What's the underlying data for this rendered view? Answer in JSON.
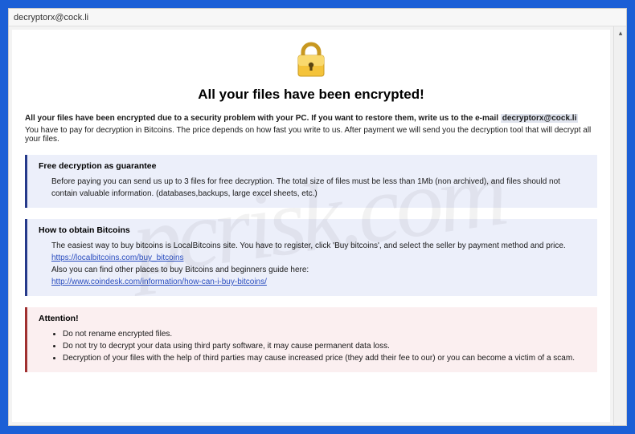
{
  "window": {
    "title": "decryptorx@cock.li"
  },
  "scrollbar": {
    "up": "▴"
  },
  "header": {
    "main_title": "All your files have been encrypted!"
  },
  "intro": {
    "bold_prefix": "All your files have been encrypted due to a security problem with your PC. If you want to restore them, write us to the e-mail",
    "email": "decryptorx@cock.li",
    "line2": "You have to pay for decryption in Bitcoins. The price depends on how fast you write to us. After payment we will send you the decryption tool that will decrypt all your files."
  },
  "sections": {
    "free": {
      "title": "Free decryption as guarantee",
      "body": "Before paying you can send us up to 3 files for free decryption. The total size of files must be less than 1Mb (non archived), and files should not contain valuable information. (databases,backups, large excel sheets, etc.)"
    },
    "howto": {
      "title": "How to obtain Bitcoins",
      "line1": "The easiest way to buy bitcoins is LocalBitcoins site. You have to register, click 'Buy bitcoins', and select the seller by payment method and price.",
      "link1": "https://localbitcoins.com/buy_bitcoins",
      "line2": "Also you can find other places to buy Bitcoins and beginners guide here:",
      "link2": "http://www.coindesk.com/information/how-can-i-buy-bitcoins/"
    },
    "attention": {
      "title": "Attention!",
      "items": [
        "Do not rename encrypted files.",
        "Do not try to decrypt your data using third party software, it may cause permanent data loss.",
        "Decryption of your files with the help of third parties may cause increased price (they add their fee to our) or you can become a victim of a scam."
      ]
    }
  },
  "watermark": "pcrisk.com"
}
